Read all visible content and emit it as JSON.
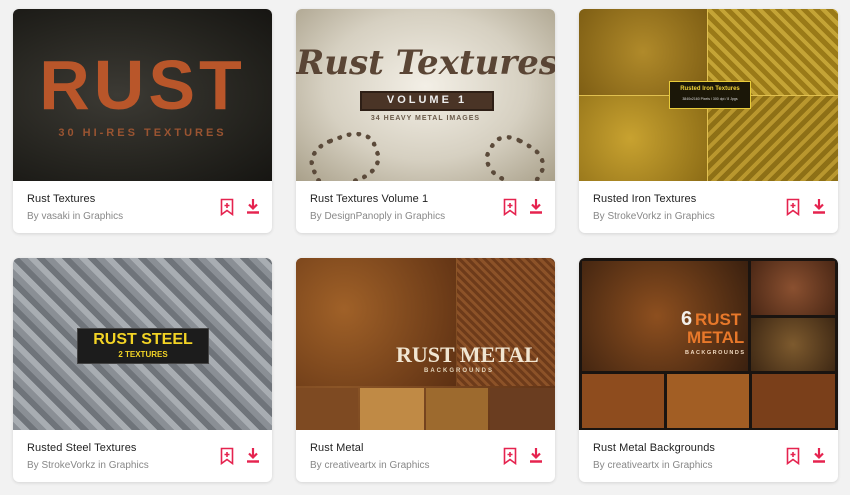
{
  "cards": [
    {
      "title": "Rust Textures",
      "author": "By vasaki in Graphics",
      "thumb_text": {
        "headline": "RUST",
        "sub": "30 HI-RES TEXTURES"
      }
    },
    {
      "title": "Rust Textures Volume 1",
      "author": "By DesignPanoply in Graphics",
      "thumb_text": {
        "headline": "Rust Textures",
        "badge": "VOLUME 1",
        "sub": "34 HEAVY METAL IMAGES"
      }
    },
    {
      "title": "Rusted Iron Textures",
      "author": "By StrokeVorkz in Graphics",
      "thumb_text": {
        "headline": "Rusted Iron Textures",
        "sub": "3840x2160 Pixels / 300 dpi / 8 Jpgs"
      }
    },
    {
      "title": "Rusted Steel Textures",
      "author": "By StrokeVorkz in Graphics",
      "thumb_text": {
        "headline": "RUST STEEL",
        "sub": "2 TEXTURES"
      }
    },
    {
      "title": "Rust Metal",
      "author": "By creativeartx in Graphics",
      "thumb_text": {
        "headline": "RUST METAL",
        "sub": "BACKGROUNDS"
      }
    },
    {
      "title": "Rust Metal Backgrounds",
      "author": "By creativeartx in Graphics",
      "thumb_text": {
        "num": "6",
        "headline": "RUST",
        "headline2": "METAL",
        "sub": "BACKGROUNDS"
      }
    }
  ],
  "icons": {
    "bookmark": "bookmark-add-icon",
    "download": "download-icon"
  },
  "colors": {
    "accent": "#e5234f",
    "background": "#f2f2f2"
  }
}
